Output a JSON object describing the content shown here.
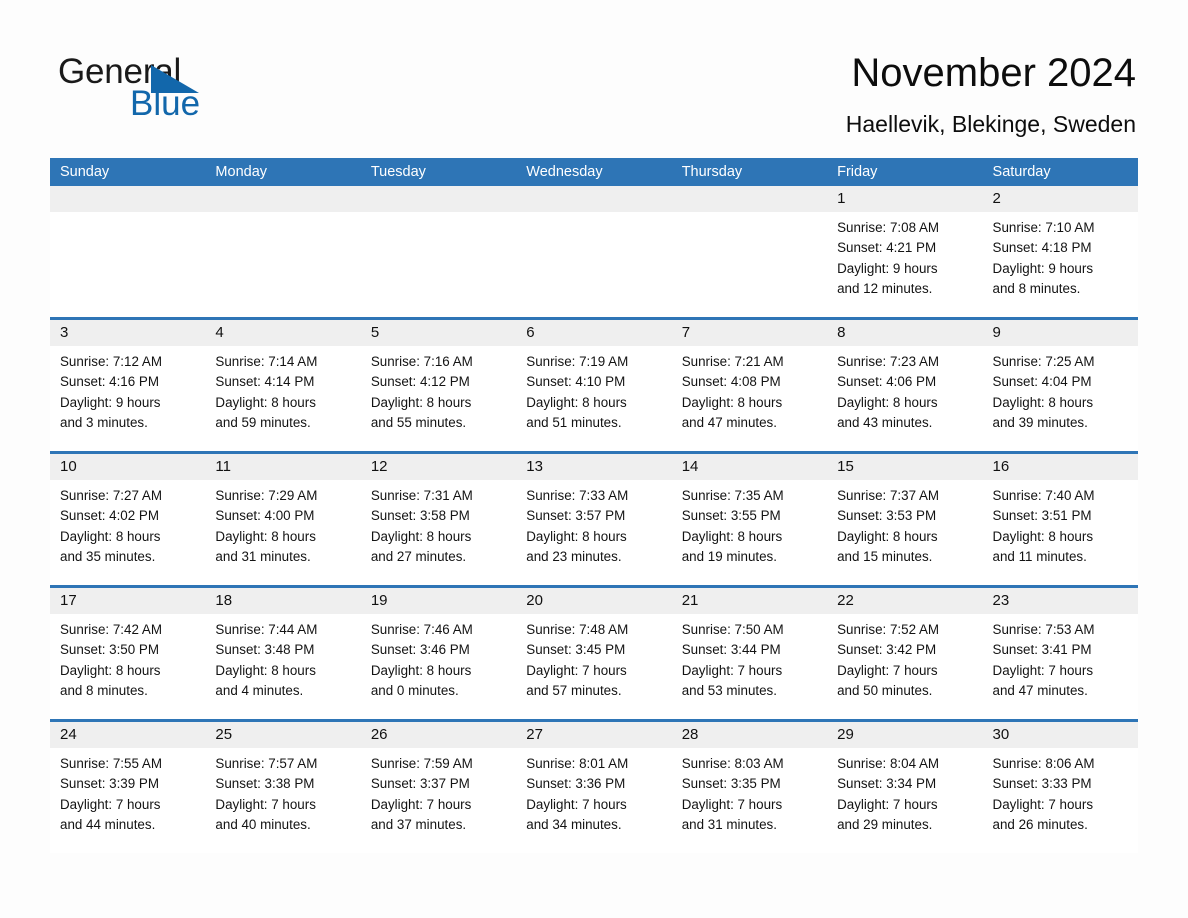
{
  "brand": {
    "name_part1": "General",
    "name_part2": "Blue",
    "triangle_color": "#1267ab",
    "accent_color": "#2e75b6"
  },
  "header": {
    "title": "November 2024",
    "subtitle": "Haellevik, Blekinge, Sweden"
  },
  "weekdays": [
    "Sunday",
    "Monday",
    "Tuesday",
    "Wednesday",
    "Thursday",
    "Friday",
    "Saturday"
  ],
  "weeks": [
    [
      {
        "day": "",
        "lines": []
      },
      {
        "day": "",
        "lines": []
      },
      {
        "day": "",
        "lines": []
      },
      {
        "day": "",
        "lines": []
      },
      {
        "day": "",
        "lines": []
      },
      {
        "day": "1",
        "lines": [
          "Sunrise: 7:08 AM",
          "Sunset: 4:21 PM",
          "Daylight: 9 hours",
          "and 12 minutes."
        ]
      },
      {
        "day": "2",
        "lines": [
          "Sunrise: 7:10 AM",
          "Sunset: 4:18 PM",
          "Daylight: 9 hours",
          "and 8 minutes."
        ]
      }
    ],
    [
      {
        "day": "3",
        "lines": [
          "Sunrise: 7:12 AM",
          "Sunset: 4:16 PM",
          "Daylight: 9 hours",
          "and 3 minutes."
        ]
      },
      {
        "day": "4",
        "lines": [
          "Sunrise: 7:14 AM",
          "Sunset: 4:14 PM",
          "Daylight: 8 hours",
          "and 59 minutes."
        ]
      },
      {
        "day": "5",
        "lines": [
          "Sunrise: 7:16 AM",
          "Sunset: 4:12 PM",
          "Daylight: 8 hours",
          "and 55 minutes."
        ]
      },
      {
        "day": "6",
        "lines": [
          "Sunrise: 7:19 AM",
          "Sunset: 4:10 PM",
          "Daylight: 8 hours",
          "and 51 minutes."
        ]
      },
      {
        "day": "7",
        "lines": [
          "Sunrise: 7:21 AM",
          "Sunset: 4:08 PM",
          "Daylight: 8 hours",
          "and 47 minutes."
        ]
      },
      {
        "day": "8",
        "lines": [
          "Sunrise: 7:23 AM",
          "Sunset: 4:06 PM",
          "Daylight: 8 hours",
          "and 43 minutes."
        ]
      },
      {
        "day": "9",
        "lines": [
          "Sunrise: 7:25 AM",
          "Sunset: 4:04 PM",
          "Daylight: 8 hours",
          "and 39 minutes."
        ]
      }
    ],
    [
      {
        "day": "10",
        "lines": [
          "Sunrise: 7:27 AM",
          "Sunset: 4:02 PM",
          "Daylight: 8 hours",
          "and 35 minutes."
        ]
      },
      {
        "day": "11",
        "lines": [
          "Sunrise: 7:29 AM",
          "Sunset: 4:00 PM",
          "Daylight: 8 hours",
          "and 31 minutes."
        ]
      },
      {
        "day": "12",
        "lines": [
          "Sunrise: 7:31 AM",
          "Sunset: 3:58 PM",
          "Daylight: 8 hours",
          "and 27 minutes."
        ]
      },
      {
        "day": "13",
        "lines": [
          "Sunrise: 7:33 AM",
          "Sunset: 3:57 PM",
          "Daylight: 8 hours",
          "and 23 minutes."
        ]
      },
      {
        "day": "14",
        "lines": [
          "Sunrise: 7:35 AM",
          "Sunset: 3:55 PM",
          "Daylight: 8 hours",
          "and 19 minutes."
        ]
      },
      {
        "day": "15",
        "lines": [
          "Sunrise: 7:37 AM",
          "Sunset: 3:53 PM",
          "Daylight: 8 hours",
          "and 15 minutes."
        ]
      },
      {
        "day": "16",
        "lines": [
          "Sunrise: 7:40 AM",
          "Sunset: 3:51 PM",
          "Daylight: 8 hours",
          "and 11 minutes."
        ]
      }
    ],
    [
      {
        "day": "17",
        "lines": [
          "Sunrise: 7:42 AM",
          "Sunset: 3:50 PM",
          "Daylight: 8 hours",
          "and 8 minutes."
        ]
      },
      {
        "day": "18",
        "lines": [
          "Sunrise: 7:44 AM",
          "Sunset: 3:48 PM",
          "Daylight: 8 hours",
          "and 4 minutes."
        ]
      },
      {
        "day": "19",
        "lines": [
          "Sunrise: 7:46 AM",
          "Sunset: 3:46 PM",
          "Daylight: 8 hours",
          "and 0 minutes."
        ]
      },
      {
        "day": "20",
        "lines": [
          "Sunrise: 7:48 AM",
          "Sunset: 3:45 PM",
          "Daylight: 7 hours",
          "and 57 minutes."
        ]
      },
      {
        "day": "21",
        "lines": [
          "Sunrise: 7:50 AM",
          "Sunset: 3:44 PM",
          "Daylight: 7 hours",
          "and 53 minutes."
        ]
      },
      {
        "day": "22",
        "lines": [
          "Sunrise: 7:52 AM",
          "Sunset: 3:42 PM",
          "Daylight: 7 hours",
          "and 50 minutes."
        ]
      },
      {
        "day": "23",
        "lines": [
          "Sunrise: 7:53 AM",
          "Sunset: 3:41 PM",
          "Daylight: 7 hours",
          "and 47 minutes."
        ]
      }
    ],
    [
      {
        "day": "24",
        "lines": [
          "Sunrise: 7:55 AM",
          "Sunset: 3:39 PM",
          "Daylight: 7 hours",
          "and 44 minutes."
        ]
      },
      {
        "day": "25",
        "lines": [
          "Sunrise: 7:57 AM",
          "Sunset: 3:38 PM",
          "Daylight: 7 hours",
          "and 40 minutes."
        ]
      },
      {
        "day": "26",
        "lines": [
          "Sunrise: 7:59 AM",
          "Sunset: 3:37 PM",
          "Daylight: 7 hours",
          "and 37 minutes."
        ]
      },
      {
        "day": "27",
        "lines": [
          "Sunrise: 8:01 AM",
          "Sunset: 3:36 PM",
          "Daylight: 7 hours",
          "and 34 minutes."
        ]
      },
      {
        "day": "28",
        "lines": [
          "Sunrise: 8:03 AM",
          "Sunset: 3:35 PM",
          "Daylight: 7 hours",
          "and 31 minutes."
        ]
      },
      {
        "day": "29",
        "lines": [
          "Sunrise: 8:04 AM",
          "Sunset: 3:34 PM",
          "Daylight: 7 hours",
          "and 29 minutes."
        ]
      },
      {
        "day": "30",
        "lines": [
          "Sunrise: 8:06 AM",
          "Sunset: 3:33 PM",
          "Daylight: 7 hours",
          "and 26 minutes."
        ]
      }
    ]
  ]
}
